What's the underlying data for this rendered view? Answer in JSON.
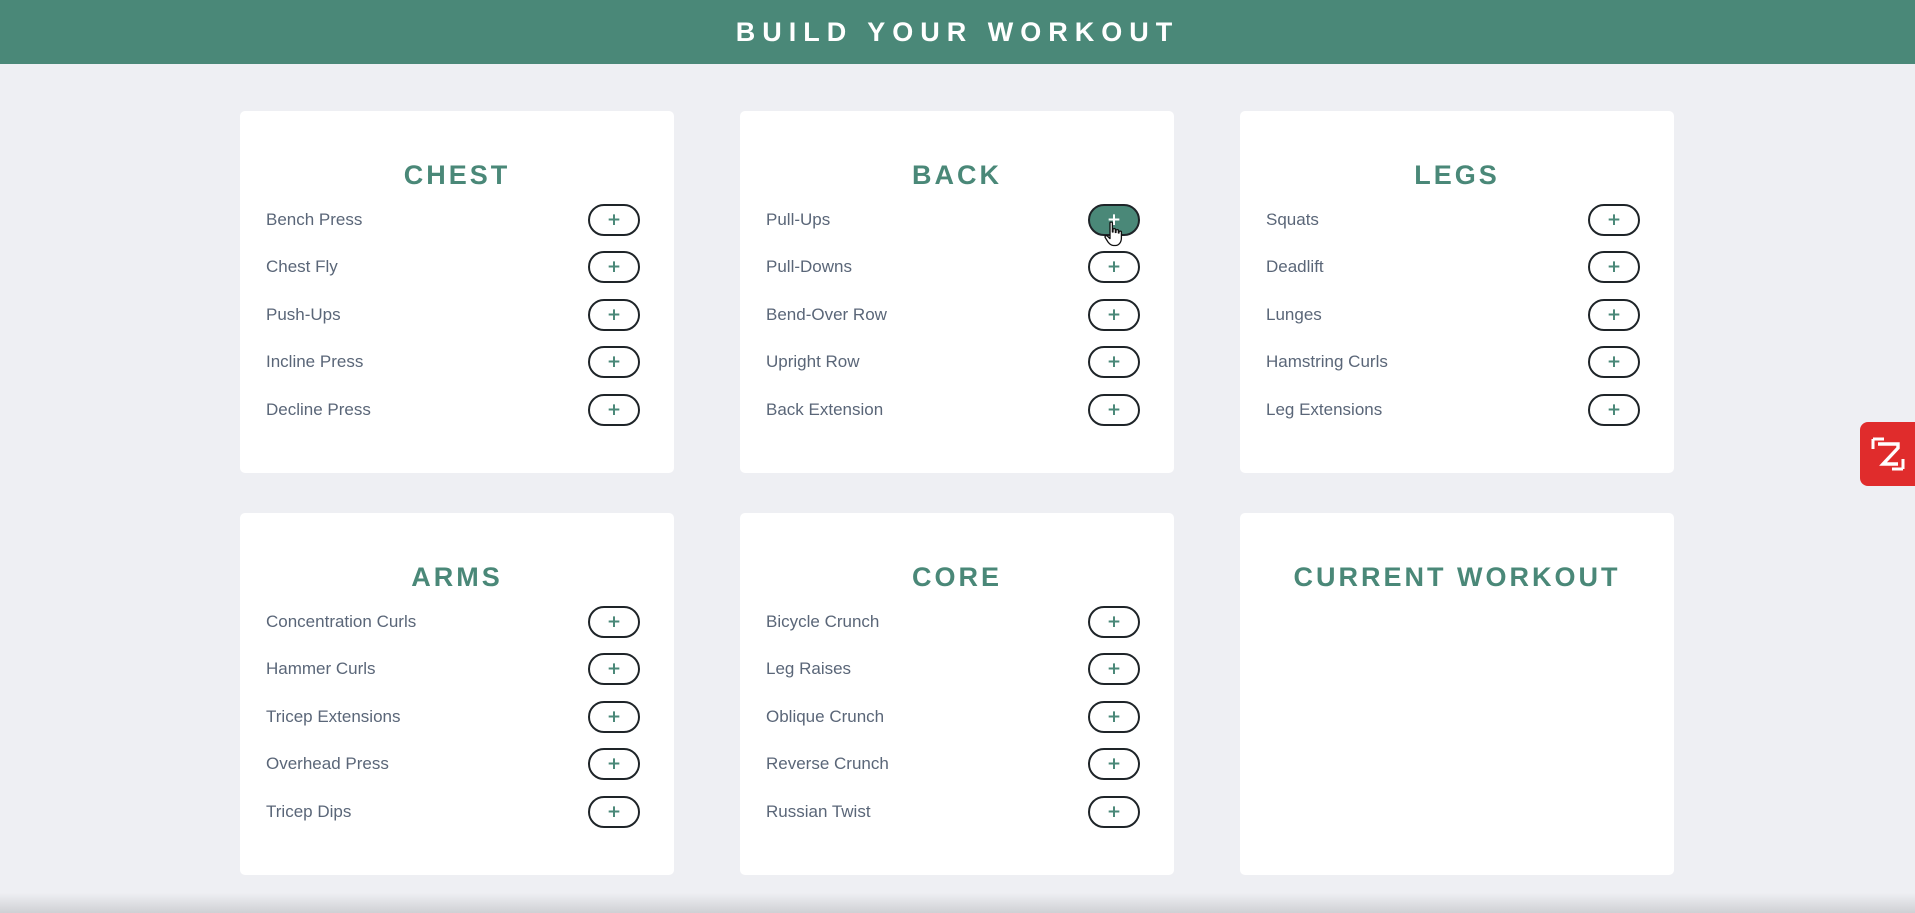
{
  "header": {
    "title": "BUILD YOUR WORKOUT"
  },
  "add_label": "+",
  "sections": [
    {
      "title": "CHEST",
      "exercises": [
        "Bench Press",
        "Chest Fly",
        "Push-Ups",
        "Incline Press",
        "Decline Press"
      ]
    },
    {
      "title": "BACK",
      "exercises": [
        "Pull-Ups",
        "Pull-Downs",
        "Bend-Over Row",
        "Upright Row",
        "Back Extension"
      ]
    },
    {
      "title": "LEGS",
      "exercises": [
        "Squats",
        "Deadlift",
        "Lunges",
        "Hamstring Curls",
        "Leg Extensions"
      ]
    },
    {
      "title": "ARMS",
      "exercises": [
        "Concentration Curls",
        "Hammer Curls",
        "Tricep Extensions",
        "Overhead Press",
        "Tricep Dips"
      ]
    },
    {
      "title": "CORE",
      "exercises": [
        "Bicycle Crunch",
        "Leg Raises",
        "Oblique Crunch",
        "Reverse Crunch",
        "Russian Twist"
      ]
    }
  ],
  "current_workout": {
    "title": "CURRENT WORKOUT",
    "items": []
  },
  "colors": {
    "accent": "#4a8878",
    "background": "#eeeff3",
    "text": "#5a6678",
    "widget": "#e02c2c"
  },
  "icons": {
    "cursor": "hand-pointer-icon",
    "widget": "zoho-logo-icon"
  }
}
